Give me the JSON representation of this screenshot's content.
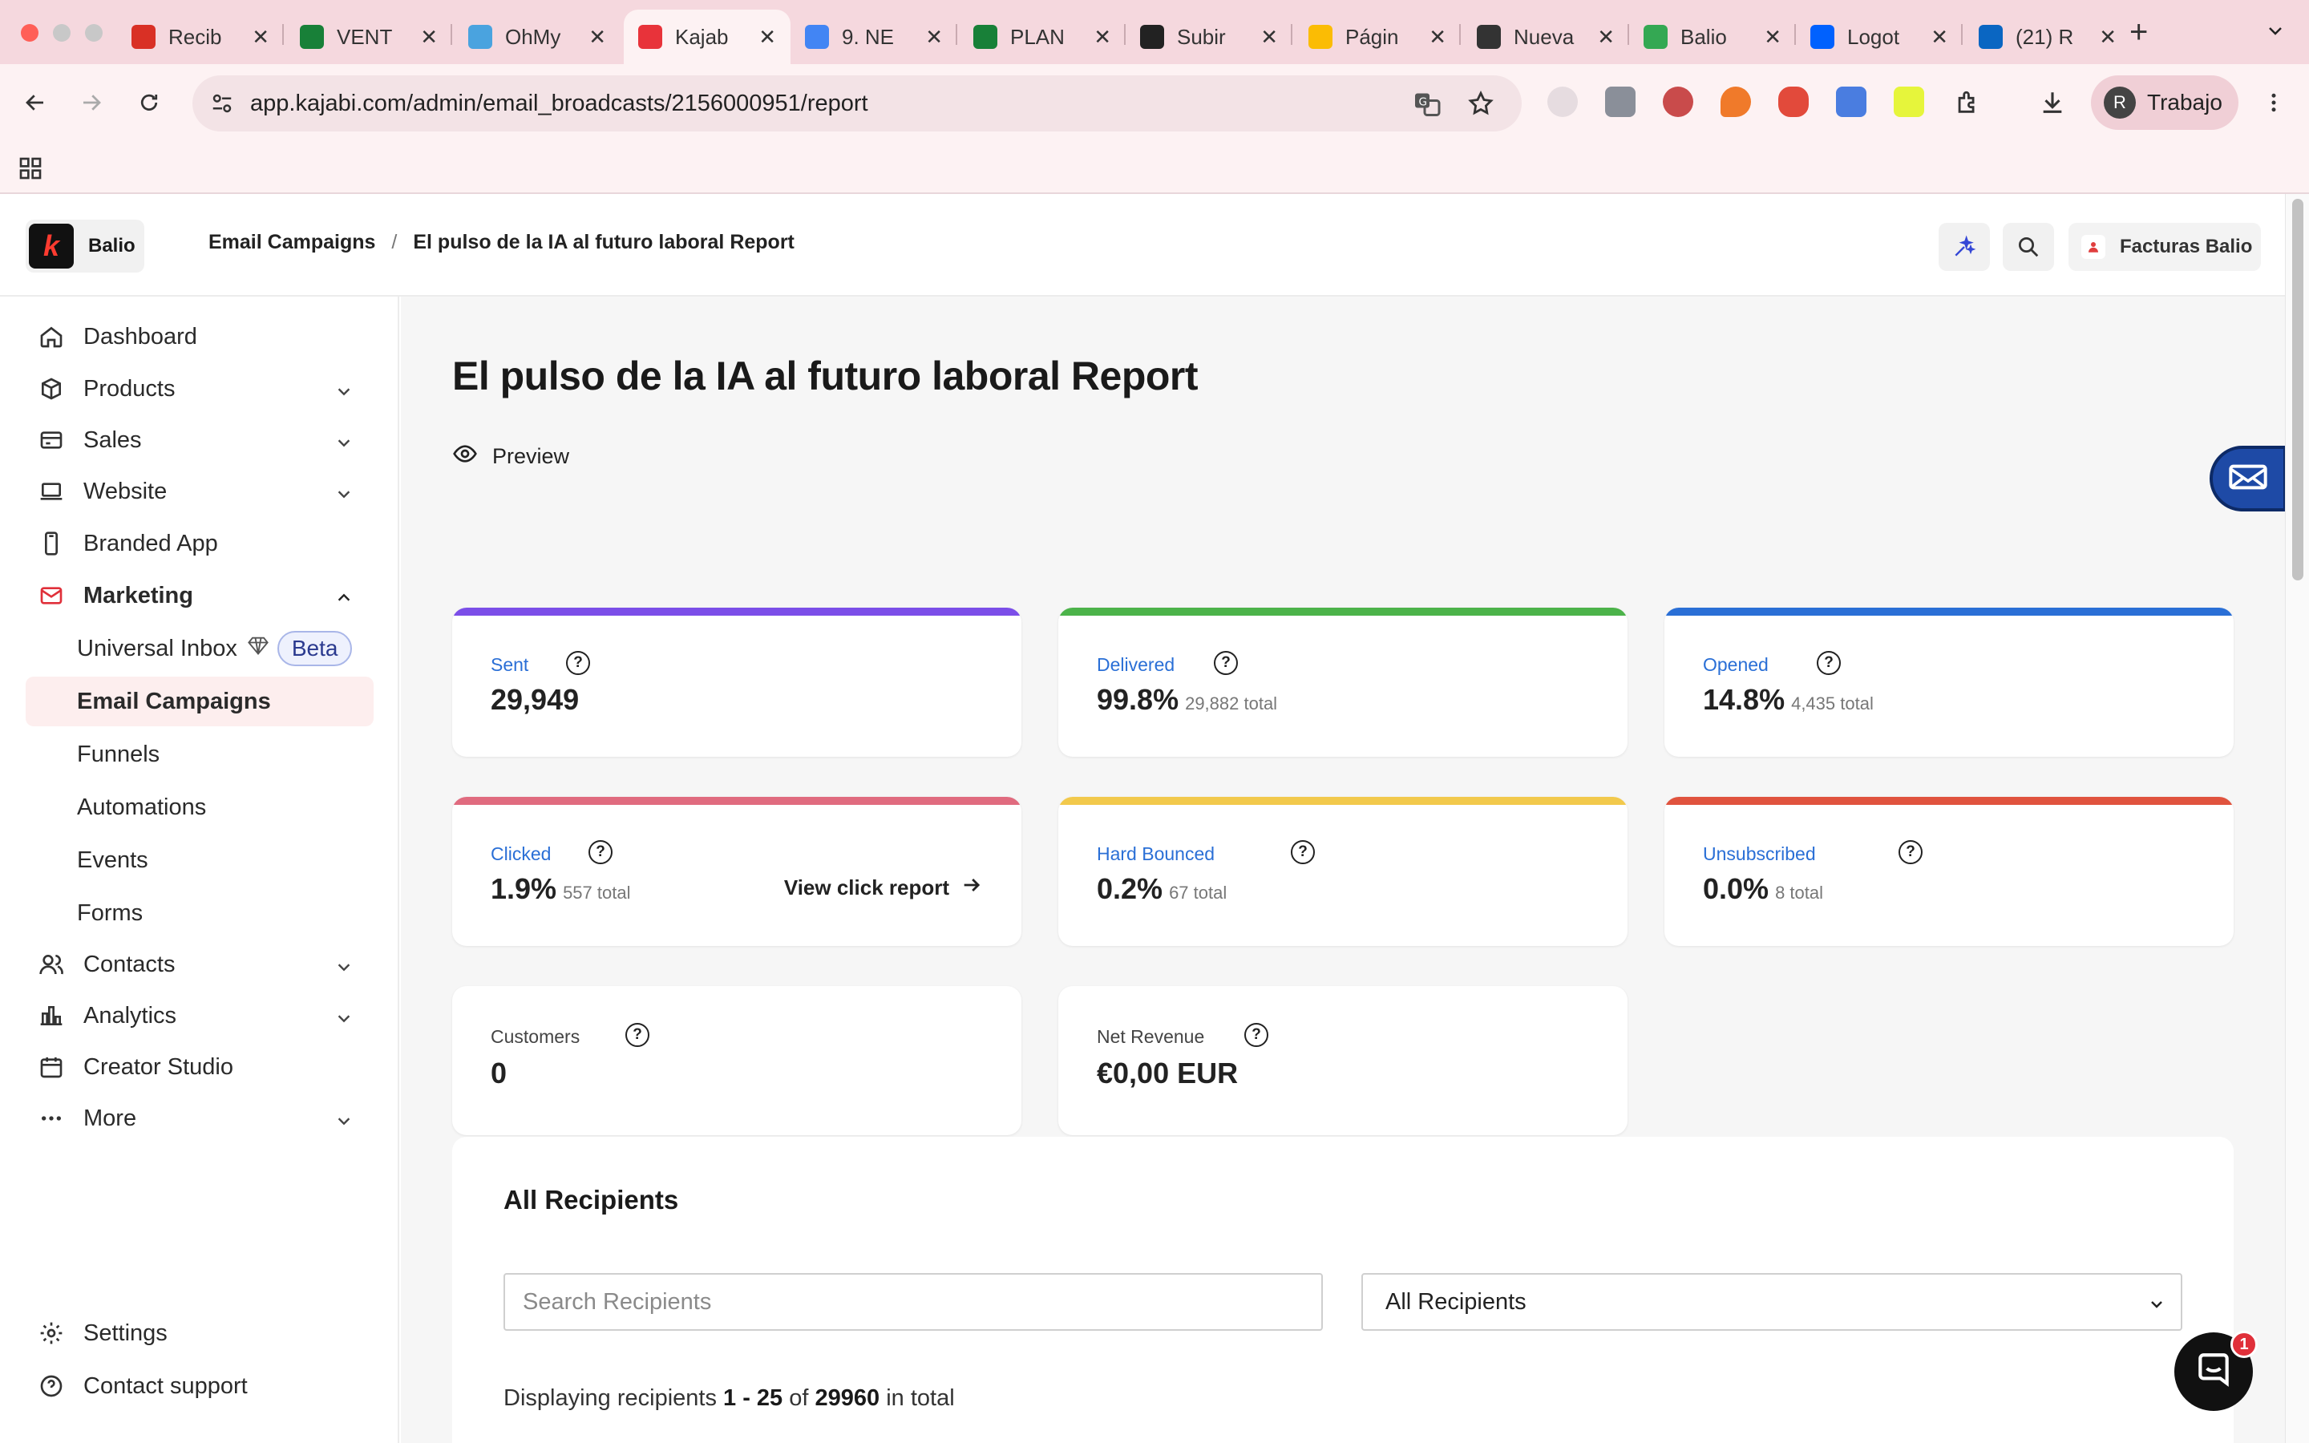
{
  "browser": {
    "tabs": [
      {
        "title": "Recib",
        "favicon": "gmail-icon",
        "color": "#d93025",
        "active": false
      },
      {
        "title": "VENT",
        "favicon": "sheets-icon",
        "color": "#188038",
        "active": false
      },
      {
        "title": "OhMy",
        "favicon": "ohmy-icon",
        "color": "#4aa3df",
        "active": false
      },
      {
        "title": "Kajab",
        "favicon": "kajabi-icon",
        "color": "#e8333a",
        "active": true
      },
      {
        "title": "9. NE",
        "favicon": "docs-icon",
        "color": "#4285f4",
        "active": false
      },
      {
        "title": "PLAN",
        "favicon": "sheets-icon",
        "color": "#188038",
        "active": false
      },
      {
        "title": "Subir",
        "favicon": "openai-icon",
        "color": "#222222",
        "active": false
      },
      {
        "title": "Págin",
        "favicon": "drive-icon",
        "color": "#fbbc04",
        "active": false
      },
      {
        "title": "Nueva",
        "favicon": "chrome-icon",
        "color": "#333333",
        "active": false
      },
      {
        "title": "Balio",
        "favicon": "balio-icon",
        "color": "#34a853",
        "active": false
      },
      {
        "title": "Logot",
        "favicon": "dropbox-icon",
        "color": "#0061fe",
        "active": false
      },
      {
        "title": "(21) R",
        "favicon": "linkedin-icon",
        "color": "#0a66c2",
        "active": false
      }
    ],
    "url": "app.kajabi.com/admin/email_broadcasts/2156000951/report",
    "profile_initial": "R",
    "profile_name": "Trabajo"
  },
  "app": {
    "brand_name": "Balio",
    "breadcrumb": {
      "parent": "Email Campaigns",
      "separator": "/",
      "current": "El pulso de la IA al futuro laboral Report"
    },
    "account_name": "Facturas Balio"
  },
  "sidebar": {
    "items": [
      {
        "label": "Dashboard",
        "icon": "home-icon",
        "chevron": false
      },
      {
        "label": "Products",
        "icon": "box-icon",
        "chevron": true
      },
      {
        "label": "Sales",
        "icon": "card-icon",
        "chevron": true
      },
      {
        "label": "Website",
        "icon": "laptop-icon",
        "chevron": true
      },
      {
        "label": "Branded App",
        "icon": "phone-icon",
        "chevron": false
      },
      {
        "label": "Marketing",
        "icon": "mail-icon",
        "chevron": true,
        "expanded": true
      },
      {
        "label": "Contacts",
        "icon": "people-icon",
        "chevron": true
      },
      {
        "label": "Analytics",
        "icon": "chart-icon",
        "chevron": true
      },
      {
        "label": "Creator Studio",
        "icon": "calendar-icon",
        "chevron": false
      },
      {
        "label": "More",
        "icon": "dots-icon",
        "chevron": true
      }
    ],
    "marketing_sub": [
      {
        "label": "Universal Inbox",
        "badge": "Beta"
      },
      {
        "label": "Email Campaigns",
        "active": true
      },
      {
        "label": "Funnels"
      },
      {
        "label": "Automations"
      },
      {
        "label": "Events"
      },
      {
        "label": "Forms"
      }
    ],
    "footer": [
      {
        "label": "Settings",
        "icon": "gear-icon"
      },
      {
        "label": "Contact support",
        "icon": "help-icon"
      }
    ]
  },
  "report": {
    "title": "El pulso de la IA al futuro laboral Report",
    "preview_label": "Preview",
    "stats": [
      {
        "label": "Sent",
        "value": "29,949",
        "sub": "",
        "color": "#7b4ee8"
      },
      {
        "label": "Delivered",
        "value": "99.8%",
        "sub": "29,882 total",
        "color": "#4cb34a"
      },
      {
        "label": "Opened",
        "value": "14.8%",
        "sub": "4,435 total",
        "color": "#2a6fd6"
      },
      {
        "label": "Clicked",
        "value": "1.9%",
        "sub": "557 total",
        "color": "#e06b7f",
        "link": "View click report"
      },
      {
        "label": "Hard Bounced",
        "value": "0.2%",
        "sub": "67 total",
        "color": "#f2c94c"
      },
      {
        "label": "Unsubscribed",
        "value": "0.0%",
        "sub": "8 total",
        "color": "#e0533e"
      },
      {
        "label": "Customers",
        "value": "0",
        "sub": ""
      },
      {
        "label": "Net Revenue",
        "value": "€0,00 EUR",
        "sub": ""
      }
    ],
    "help_glyph": "?"
  },
  "recipients": {
    "heading": "All Recipients",
    "search_placeholder": "Search Recipients",
    "filter_value": "All Recipients",
    "summary": {
      "prefix": "Displaying recipients",
      "range": "1 - 25",
      "of": "of",
      "total": "29960",
      "suffix": "in total"
    }
  },
  "chat": {
    "unread": "1"
  }
}
